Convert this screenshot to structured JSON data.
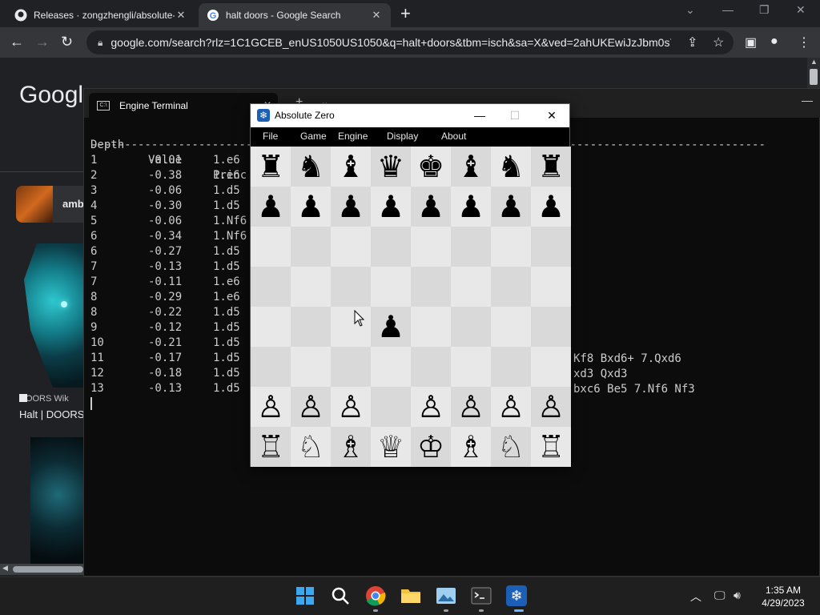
{
  "browser": {
    "tabs": [
      {
        "title": "Releases · zongzhengli/absolute-",
        "active": false
      },
      {
        "title": "halt doors - Google Search",
        "active": true
      }
    ],
    "address": "google.com/search?rlz=1C1GCEB_enUS1050US1050&q=halt+doors&tbm=isch&sa=X&ved=2ahUKEwiJzJbm0s7…",
    "page": {
      "logo": "Googl",
      "chip_label": "amb",
      "source_label": "DOORS Wik",
      "image_title": "Halt | DOORS"
    }
  },
  "terminal": {
    "tab_title": "Engine Terminal",
    "headers": {
      "depth": "Depth",
      "value": "Value",
      "principal": "Princ"
    },
    "separator": "----------------------------------------------------------------------------------------------------",
    "rows": [
      {
        "depth": "1",
        "value": "-0.01",
        "pv": "1.e6"
      },
      {
        "depth": "2",
        "value": "-0.38",
        "pv": "1.e6"
      },
      {
        "depth": "3",
        "value": "-0.06",
        "pv": "1.d5"
      },
      {
        "depth": "4",
        "value": "-0.30",
        "pv": "1.d5"
      },
      {
        "depth": "5",
        "value": "-0.06",
        "pv": "1.Nf6"
      },
      {
        "depth": "6",
        "value": "-0.34",
        "pv": "1.Nf6"
      },
      {
        "depth": "6",
        "value": "-0.27",
        "pv": "1.d5"
      },
      {
        "depth": "7",
        "value": "-0.13",
        "pv": "1.d5"
      },
      {
        "depth": "7",
        "value": "-0.11",
        "pv": "1.e6"
      },
      {
        "depth": "8",
        "value": "-0.29",
        "pv": "1.e6"
      },
      {
        "depth": "8",
        "value": "-0.22",
        "pv": "1.d5"
      },
      {
        "depth": "9",
        "value": "-0.12",
        "pv": "1.d5"
      },
      {
        "depth": "10",
        "value": "-0.21",
        "pv": "1.d5"
      },
      {
        "depth": "11",
        "value": "-0.17",
        "pv": "1.d5"
      },
      {
        "depth": "12",
        "value": "-0.18",
        "pv": "1.d5"
      },
      {
        "depth": "13",
        "value": "-0.13",
        "pv": "1.d5"
      }
    ],
    "tails": {
      "row11": "Kf8 Bxd6+ 7.Qxd6",
      "row12": "xd3 Qxd3",
      "row13": "bxc6 Be5 7.Nf6 Nf3"
    }
  },
  "absolute_zero": {
    "title": "Absolute Zero",
    "menu": [
      "File",
      "Game",
      "Engine",
      "Display",
      "About"
    ],
    "board": [
      [
        "♜",
        "♞",
        "♝",
        "♛",
        "♚",
        "♝",
        "♞",
        "♜"
      ],
      [
        "♟",
        "♟",
        "♟",
        "♟",
        "♟",
        "♟",
        "♟",
        "♟"
      ],
      [
        "",
        "",
        "",
        "",
        "",
        "",
        "",
        ""
      ],
      [
        "",
        "",
        "",
        "",
        "",
        "",
        "",
        ""
      ],
      [
        "",
        "",
        "",
        "♟",
        "",
        "",
        "",
        ""
      ],
      [
        "",
        "",
        "",
        "",
        "",
        "",
        "",
        ""
      ],
      [
        "♙",
        "♙",
        "♙",
        "",
        "♙",
        "♙",
        "♙",
        "♙"
      ],
      [
        "♖",
        "♘",
        "♗",
        "♕",
        "♔",
        "♗",
        "♘",
        "♖"
      ]
    ]
  },
  "taskbar": {
    "time": "1:35 AM",
    "date": "4/29/2023",
    "apps": [
      "start-icon",
      "search-icon",
      "chrome-icon",
      "file-explorer-icon",
      "photos-icon",
      "terminal-icon",
      "absolute-zero-icon"
    ]
  }
}
